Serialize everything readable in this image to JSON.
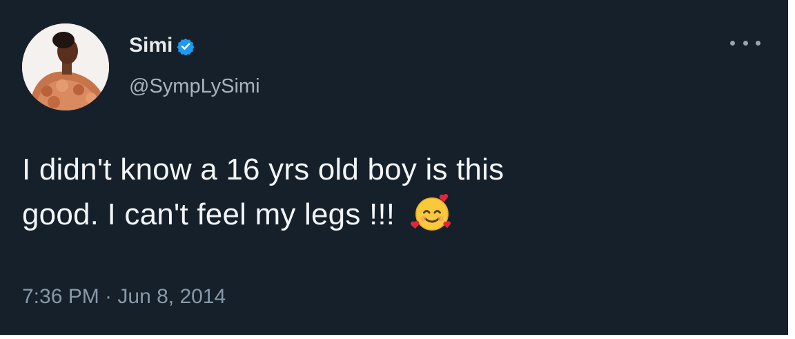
{
  "tweet": {
    "display_name": "Simi",
    "handle": "@SympLySimi",
    "text_line1": "I didn't know a 16 yrs old boy is this",
    "text_line2": "good. I can't feel my legs !!!",
    "emoji": "smiling-face-with-hearts",
    "timestamp": "7:36 PM · Jun 8, 2014"
  },
  "icons": {
    "verified": "verified-badge-icon",
    "more": "more-options-icon"
  },
  "colors": {
    "background": "#15202b",
    "verified": "#1d9bf0",
    "secondary_text": "#8899a6"
  }
}
